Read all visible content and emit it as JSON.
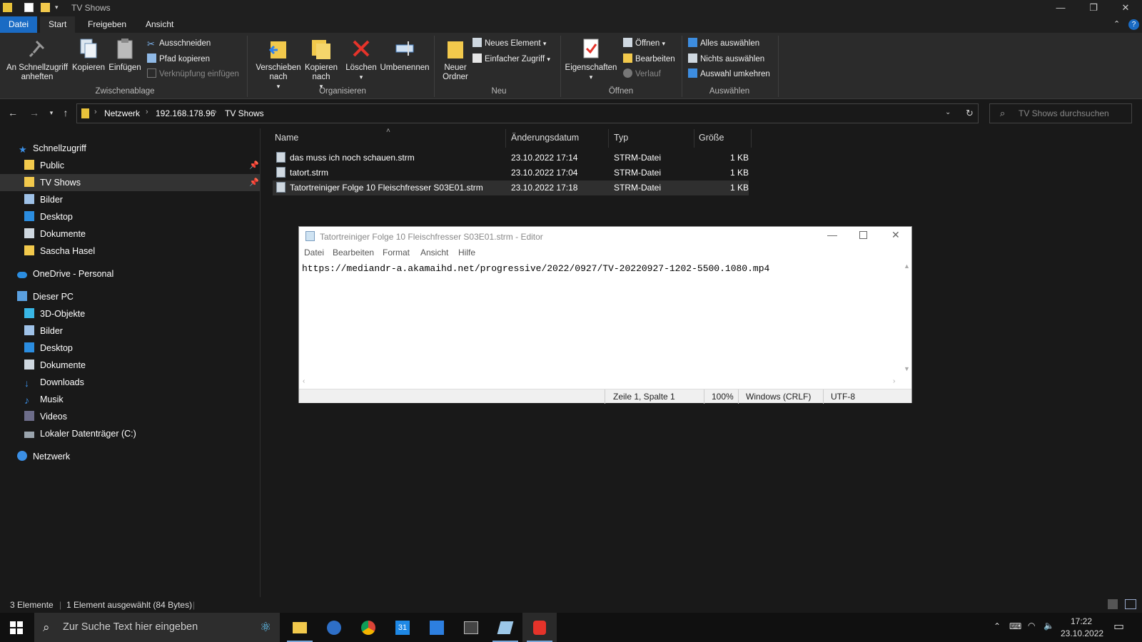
{
  "window": {
    "title": "TV Shows",
    "minimize_glyph": "—",
    "restore_glyph": "❐",
    "close_glyph": "✕"
  },
  "ribbon_tabs": [
    "Datei",
    "Start",
    "Freigeben",
    "Ansicht"
  ],
  "ribbon": {
    "clipboard": {
      "pin_label": "An Schnellzugriff anheften",
      "copy_label": "Kopieren",
      "paste_label": "Einfügen",
      "cut_label": "Ausschneiden",
      "copy_path_label": "Pfad kopieren",
      "paste_shortcut_label": "Verknüpfung einfügen",
      "group_label": "Zwischenablage"
    },
    "organize": {
      "move_label": "Verschieben nach",
      "copyto_label": "Kopieren nach",
      "delete_label": "Löschen",
      "rename_label": "Umbenennen",
      "group_label": "Organisieren"
    },
    "new": {
      "new_folder_label": "Neuer Ordner",
      "new_item_label": "Neues Element",
      "easy_access_label": "Einfacher Zugriff",
      "group_label": "Neu"
    },
    "open": {
      "properties_label": "Eigenschaften",
      "open_label": "Öffnen",
      "edit_label": "Bearbeiten",
      "history_label": "Verlauf",
      "group_label": "Öffnen"
    },
    "select": {
      "select_all_label": "Alles auswählen",
      "select_none_label": "Nichts auswählen",
      "invert_label": "Auswahl umkehren",
      "group_label": "Auswählen"
    }
  },
  "address": {
    "crumbs": [
      "Netzwerk",
      "192.168.178.96",
      "TV Shows"
    ],
    "search_placeholder": "TV Shows durchsuchen"
  },
  "nav": {
    "quick_access": "Schnellzugriff",
    "quick_items": [
      "Public",
      "TV Shows",
      "Bilder",
      "Desktop",
      "Dokumente",
      "Sascha Hasel"
    ],
    "onedrive": "OneDrive - Personal",
    "this_pc": "Dieser PC",
    "pc_items": [
      "3D-Objekte",
      "Bilder",
      "Desktop",
      "Dokumente",
      "Downloads",
      "Musik",
      "Videos",
      "Lokaler Datenträger (C:)"
    ],
    "network": "Netzwerk"
  },
  "columns": {
    "name": "Name",
    "date": "Änderungsdatum",
    "type": "Typ",
    "size": "Größe"
  },
  "files": [
    {
      "name": "das muss ich noch schauen.strm",
      "date": "23.10.2022 17:14",
      "type": "STRM-Datei",
      "size": "1 KB"
    },
    {
      "name": "tatort.strm",
      "date": "23.10.2022 17:04",
      "type": "STRM-Datei",
      "size": "1 KB"
    },
    {
      "name": "Tatortreiniger Folge 10 Fleischfresser S03E01.strm",
      "date": "23.10.2022 17:18",
      "type": "STRM-Datei",
      "size": "1 KB"
    }
  ],
  "notepad": {
    "title": "Tatortreiniger Folge 10 Fleischfresser S03E01.strm - Editor",
    "menu": [
      "Datei",
      "Bearbeiten",
      "Format",
      "Ansicht",
      "Hilfe"
    ],
    "content": "https://mediandr-a.akamaihd.net/progressive/2022/0927/TV-20220927-1202-5500.1080.mp4",
    "status_pos": "Zeile 1, Spalte 1",
    "status_zoom": "100%",
    "status_eol": "Windows (CRLF)",
    "status_enc": "UTF-8"
  },
  "statusbar": {
    "count": "3 Elemente",
    "selected": "1 Element ausgewählt (84 Bytes)"
  },
  "taskbar": {
    "search_placeholder": "Zur Suche Text hier eingeben",
    "calendar_day": "31",
    "time": "17:22",
    "date": "23.10.2022"
  }
}
